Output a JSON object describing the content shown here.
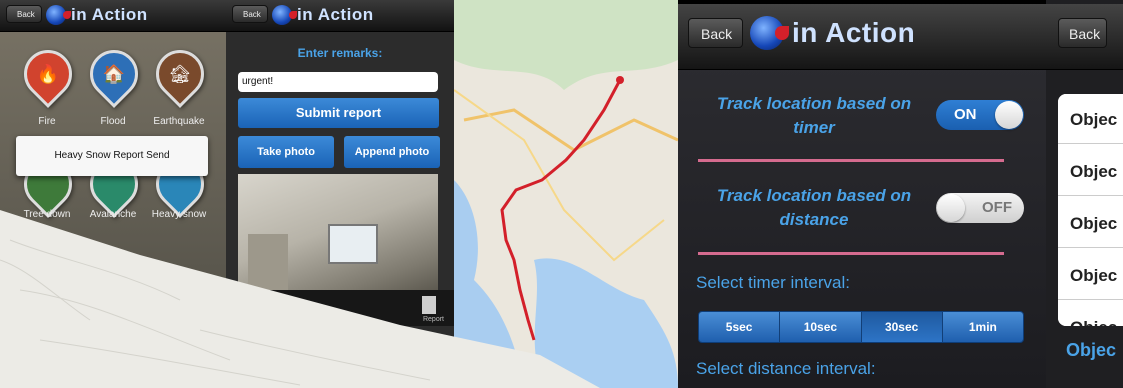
{
  "screen1": {
    "back_label": "Back",
    "logo_text": "in Action",
    "categories": [
      {
        "label": "Fire",
        "icon": "fire-icon",
        "glyph": "🔥",
        "color": "#d1432e"
      },
      {
        "label": "Flood",
        "icon": "flood-icon",
        "glyph": "🏠",
        "color": "#2d6fb7"
      },
      {
        "label": "Earthquake",
        "icon": "earthquake-icon",
        "glyph": "🏚",
        "color": "#7a4a2c"
      }
    ],
    "categories_row2": [
      "Tree down",
      "Avalanche",
      "Heavy snow"
    ],
    "toast": "Heavy Snow Report Send"
  },
  "screen2": {
    "back_label": "Back",
    "logo_text": "in Action",
    "remarks_label": "Enter remarks:",
    "remarks_value": "urgent!",
    "submit_label": "Submit report",
    "take_photo_label": "Take photo",
    "append_photo_label": "Append photo",
    "tab_label": "Report"
  },
  "screen4": {
    "back_label": "Back",
    "logo_text": "in Action",
    "track_timer_label": "Track location based on timer",
    "track_timer_state": "ON",
    "track_distance_label": "Track location based on distance",
    "track_distance_state": "OFF",
    "timer_interval_label": "Select timer interval:",
    "timer_options": [
      "5sec",
      "10sec",
      "30sec",
      "1min"
    ],
    "selected_timer": "30sec",
    "distance_interval_label": "Select distance interval:"
  },
  "screen5": {
    "back_label": "Back",
    "objects": [
      "Objec",
      "Objec",
      "Objec",
      "Objec",
      "Objec"
    ],
    "section_header": "Objec"
  },
  "colors": {
    "accent_blue": "#1f6fc9",
    "label_blue": "#4aa3e8",
    "pink_divider": "#d56b8f",
    "route_red": "#d3202a"
  }
}
